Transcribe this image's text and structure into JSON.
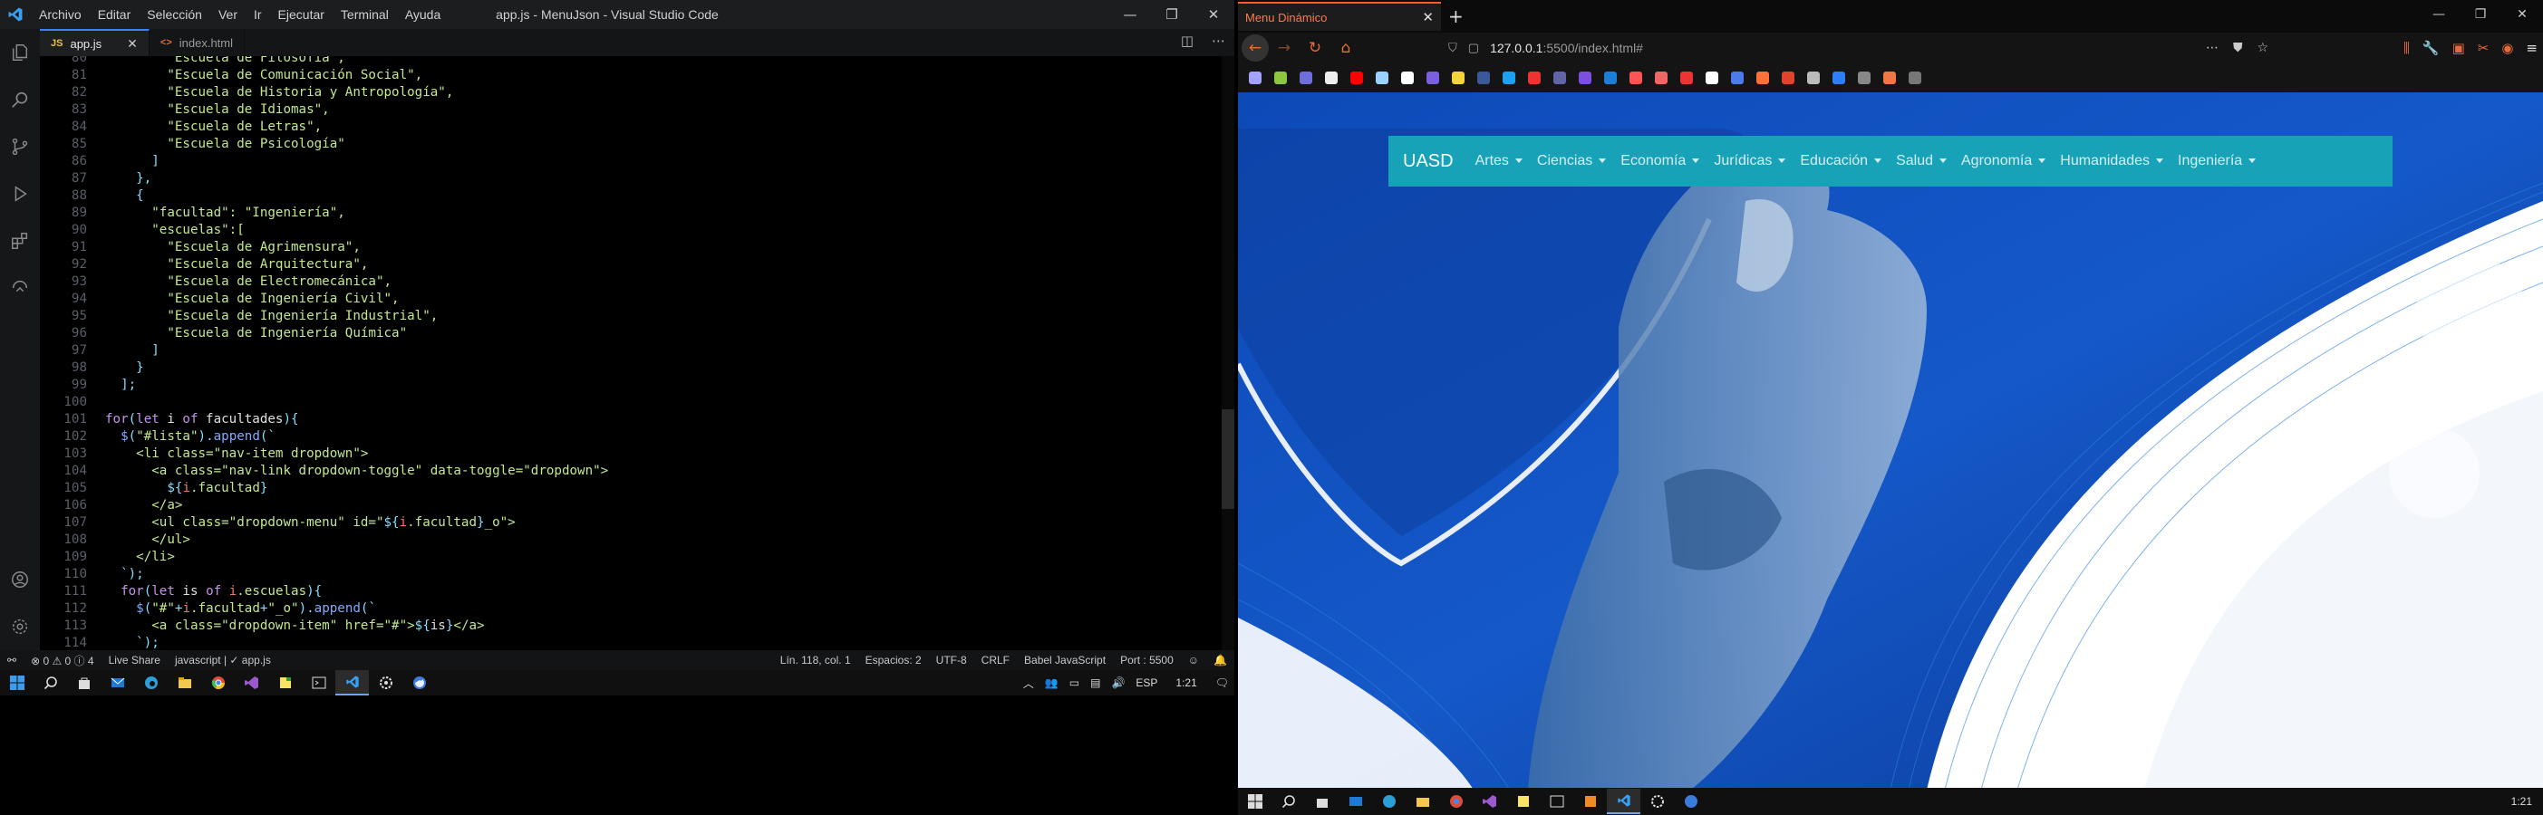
{
  "vscode": {
    "window_title": "app.js - MenuJson - Visual Studio Code",
    "menu": [
      "Archivo",
      "Editar",
      "Selección",
      "Ver",
      "Ir",
      "Ejecutar",
      "Terminal",
      "Ayuda"
    ],
    "tabs": [
      {
        "icon": "JS",
        "label": "app.js",
        "active": true
      },
      {
        "icon": "<>",
        "label": "index.html",
        "active": false
      }
    ],
    "code_lines": [
      {
        "n": "80",
        "segs": [
          [
            "        ",
            "p"
          ],
          [
            "\"Escuela de Filosofía\",",
            "s"
          ]
        ]
      },
      {
        "n": "81",
        "segs": [
          [
            "        ",
            "p"
          ],
          [
            "\"Escuela de Comunicación Social\",",
            "s"
          ]
        ]
      },
      {
        "n": "82",
        "segs": [
          [
            "        ",
            "p"
          ],
          [
            "\"Escuela de Historia y Antropología\",",
            "s"
          ]
        ]
      },
      {
        "n": "83",
        "segs": [
          [
            "        ",
            "p"
          ],
          [
            "\"Escuela de Idiomas\",",
            "s"
          ]
        ]
      },
      {
        "n": "84",
        "segs": [
          [
            "        ",
            "p"
          ],
          [
            "\"Escuela de Letras\",",
            "s"
          ]
        ]
      },
      {
        "n": "85",
        "segs": [
          [
            "        ",
            "p"
          ],
          [
            "\"Escuela de Psicología\"",
            "s"
          ]
        ]
      },
      {
        "n": "86",
        "segs": [
          [
            "      ",
            "p"
          ],
          [
            "]",
            "u"
          ]
        ]
      },
      {
        "n": "87",
        "segs": [
          [
            "    ",
            "p"
          ],
          [
            "},",
            "u"
          ]
        ]
      },
      {
        "n": "88",
        "segs": [
          [
            "    ",
            "p"
          ],
          [
            "{",
            "u"
          ]
        ]
      },
      {
        "n": "89",
        "segs": [
          [
            "      ",
            "p"
          ],
          [
            "\"facultad\": \"Ingeniería\",",
            "s"
          ]
        ]
      },
      {
        "n": "90",
        "segs": [
          [
            "      ",
            "p"
          ],
          [
            "\"escuelas\":[",
            "s"
          ]
        ]
      },
      {
        "n": "91",
        "segs": [
          [
            "        ",
            "p"
          ],
          [
            "\"Escuela de Agrimensura\",",
            "s"
          ]
        ]
      },
      {
        "n": "92",
        "segs": [
          [
            "        ",
            "p"
          ],
          [
            "\"Escuela de Arquitectura\",",
            "s"
          ]
        ]
      },
      {
        "n": "93",
        "segs": [
          [
            "        ",
            "p"
          ],
          [
            "\"Escuela de Electromecánica\",",
            "s"
          ]
        ]
      },
      {
        "n": "94",
        "segs": [
          [
            "        ",
            "p"
          ],
          [
            "\"Escuela de Ingeniería Civil\",",
            "s"
          ]
        ]
      },
      {
        "n": "95",
        "segs": [
          [
            "        ",
            "p"
          ],
          [
            "\"Escuela de Ingeniería Industrial\",",
            "s"
          ]
        ]
      },
      {
        "n": "96",
        "segs": [
          [
            "        ",
            "p"
          ],
          [
            "\"Escuela de Ingeniería Química\"",
            "s"
          ]
        ]
      },
      {
        "n": "97",
        "segs": [
          [
            "      ",
            "p"
          ],
          [
            "]",
            "u"
          ]
        ]
      },
      {
        "n": "98",
        "segs": [
          [
            "    ",
            "p"
          ],
          [
            "}",
            "u"
          ]
        ]
      },
      {
        "n": "99",
        "segs": [
          [
            "  ",
            "p"
          ],
          [
            "];",
            "u"
          ]
        ]
      },
      {
        "n": "100",
        "segs": [
          [
            "",
            "p"
          ]
        ]
      },
      {
        "n": "101",
        "segs": [
          [
            "for",
            "k"
          ],
          [
            "(",
            "u"
          ],
          [
            "let",
            "k"
          ],
          [
            " i ",
            "p"
          ],
          [
            "of",
            "k"
          ],
          [
            " facultades",
            "p"
          ],
          [
            "){",
            "u"
          ]
        ]
      },
      {
        "n": "102",
        "segs": [
          [
            "  ",
            "p"
          ],
          [
            "$",
            "f"
          ],
          [
            "(",
            "u"
          ],
          [
            "\"#lista\"",
            "s"
          ],
          [
            ").",
            "u"
          ],
          [
            "append",
            "f"
          ],
          [
            "(`",
            "u"
          ]
        ]
      },
      {
        "n": "103",
        "segs": [
          [
            "    ",
            "p"
          ],
          [
            "<li class=\"nav-item dropdown\">",
            "s"
          ]
        ]
      },
      {
        "n": "104",
        "segs": [
          [
            "      ",
            "p"
          ],
          [
            "<a class=\"nav-link dropdown-toggle\" data-toggle=\"dropdown\">",
            "s"
          ]
        ]
      },
      {
        "n": "105",
        "segs": [
          [
            "        ",
            "p"
          ],
          [
            "${",
            "u"
          ],
          [
            "i",
            "v"
          ],
          [
            ".facultad",
            "s"
          ],
          [
            "}",
            "u"
          ]
        ]
      },
      {
        "n": "106",
        "segs": [
          [
            "      ",
            "p"
          ],
          [
            "</a>",
            "s"
          ]
        ]
      },
      {
        "n": "107",
        "segs": [
          [
            "      ",
            "p"
          ],
          [
            "<ul class=\"dropdown-menu\" id=\"",
            "s"
          ],
          [
            "${",
            "u"
          ],
          [
            "i",
            "v"
          ],
          [
            ".facultad",
            "s"
          ],
          [
            "}",
            "u"
          ],
          [
            "_o\">",
            "s"
          ]
        ]
      },
      {
        "n": "108",
        "segs": [
          [
            "      ",
            "p"
          ],
          [
            "</ul>",
            "s"
          ]
        ]
      },
      {
        "n": "109",
        "segs": [
          [
            "    ",
            "p"
          ],
          [
            "</li>",
            "s"
          ]
        ]
      },
      {
        "n": "110",
        "segs": [
          [
            "  ",
            "p"
          ],
          [
            "`);",
            "u"
          ]
        ]
      },
      {
        "n": "111",
        "segs": [
          [
            "  ",
            "p"
          ],
          [
            "for",
            "k"
          ],
          [
            "(",
            "u"
          ],
          [
            "let",
            "k"
          ],
          [
            " is ",
            "p"
          ],
          [
            "of",
            "k"
          ],
          [
            " ",
            "p"
          ],
          [
            "i",
            "v"
          ],
          [
            ".escuelas",
            "s"
          ],
          [
            "){",
            "u"
          ]
        ]
      },
      {
        "n": "112",
        "segs": [
          [
            "    ",
            "p"
          ],
          [
            "$",
            "f"
          ],
          [
            "(",
            "u"
          ],
          [
            "\"#\"",
            "s"
          ],
          [
            "+",
            "u"
          ],
          [
            "i",
            "v"
          ],
          [
            ".facultad",
            "s"
          ],
          [
            "+",
            "u"
          ],
          [
            "\"_o\"",
            "s"
          ],
          [
            ").",
            "u"
          ],
          [
            "append",
            "f"
          ],
          [
            "(`",
            "u"
          ]
        ]
      },
      {
        "n": "113",
        "segs": [
          [
            "      ",
            "p"
          ],
          [
            "<a class=\"dropdown-item\" href=\"#\">",
            "s"
          ],
          [
            "${",
            "u"
          ],
          [
            "is",
            "p"
          ],
          [
            "}",
            "u"
          ],
          [
            "</a>",
            "s"
          ]
        ]
      },
      {
        "n": "114",
        "segs": [
          [
            "    ",
            "p"
          ],
          [
            "`);",
            "u"
          ]
        ]
      }
    ],
    "status": {
      "problems": "⊗ 0 ⚠ 0 ⓘ 4",
      "live_share": "Live Share",
      "lang_check": "javascript | ✓ app.js",
      "position": "Lín. 118, col. 1",
      "spaces": "Espacios: 2",
      "encoding": "UTF-8",
      "eol": "CRLF",
      "language": "Babel JavaScript",
      "port": "Port : 5500"
    },
    "tray": {
      "lang": "ESP",
      "time": "1:21"
    }
  },
  "browser": {
    "tab_title": "Menu Dinámico",
    "url_host": "127.0.0.1",
    "url_rest": ":5500/index.html#",
    "navbar": {
      "brand": "UASD",
      "items": [
        "Artes",
        "Ciencias",
        "Economía",
        "Jurídicas",
        "Educación",
        "Salud",
        "Agronomía",
        "Humanidades",
        "Ingeniería"
      ],
      "color": "#17a2b8"
    },
    "clock": "1:21"
  }
}
